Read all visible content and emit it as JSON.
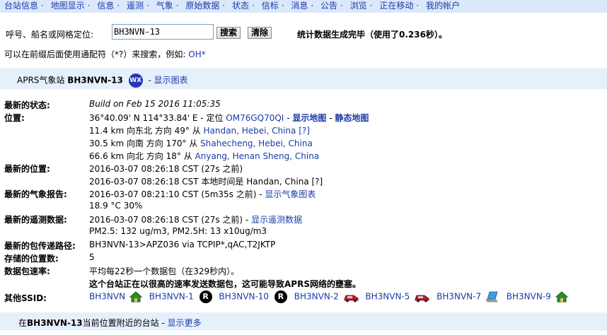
{
  "nav": {
    "items": [
      "台站信息",
      "地图显示",
      "信息",
      "遥测",
      "气象",
      "原始数据",
      "状态",
      "信标",
      "消息",
      "公告",
      "浏览",
      "正在移动",
      "我的帐户"
    ],
    "separator": "·"
  },
  "search": {
    "label": "呼号、船名或网格定位:",
    "value": "BH3NVN-13",
    "search_button": "搜索",
    "clear_button": "清除",
    "status": "统计数据生成完毕（使用了0.236秒）。",
    "hint_text": "可以在前缀后面使用通配符（*?）来搜索，例如:",
    "hint_example": "OH*"
  },
  "station": {
    "prefix": "APRS气象站",
    "callsign": "BH3NVN-13",
    "badge": "WX",
    "separator": "-",
    "chart_link": "显示图表"
  },
  "details": {
    "latest_status_label": "最新的状态:",
    "latest_status_value": "Build on Feb 15 2016 11:05:35",
    "position_label": "位置:",
    "position_coords": "36°40.09' N 114°33.84' E - 定位",
    "locator": "OM76GQ70QI",
    "dash": "-",
    "show_map": "显示地图",
    "static_map": "静态地图",
    "nearby_1_text": "11.4 km 向东北 方向 49° 从",
    "nearby_1_city": "Handan, Hebei, China",
    "nearby_1_q": "[?]",
    "nearby_2_text": "30.5 km 向南 方向 170° 从",
    "nearby_2_city": "Shahecheng, Hebei, China",
    "nearby_3_text": "66.6 km 向北 方向 18° 从",
    "nearby_3_city": "Anyang, Henan Sheng, China",
    "latest_pos_label": "最新的位置:",
    "latest_pos_time": "2016-03-07 08:26:18 CST (27s 之前)",
    "latest_pos_local": "2016-03-07 08:26:18 CST 本地时间是 Handan, China [?]",
    "weather_label": "最新的气象报告:",
    "weather_time": "2016-03-07 08:21:10 CST (5m35s 之前) -",
    "weather_link": "显示气象图表",
    "weather_values": "18.9 °C 30%",
    "telemetry_label": "最新的遥测数据:",
    "telemetry_time": "2016-03-07 08:26:18 CST (27s 之前) -",
    "telemetry_link": "显示遥测数据",
    "telemetry_values": "PM2.5: 132 ug/m3, PM2.5H: 13 x10ug/m3",
    "path_label": "最新的包传递路径:",
    "path_value": "BH3NVN-13>APZ036 via TCPIP*,qAC,T2JKTP",
    "stored_label": "存储的位置数:",
    "stored_value": "5",
    "rate_label": "数据包速率:",
    "rate_value": "平均每22秒一个数据包（在329秒内）。",
    "rate_warning": "这个台站正在以很高的速率发送数据包，这可能导致APRS网络的壅塞。",
    "ssid_label": "其他SSID:"
  },
  "ssids": [
    {
      "name": "BH3NVN",
      "icon": "house-icon"
    },
    {
      "name": "BH3NVN-1",
      "icon": "r-digipeater-icon"
    },
    {
      "name": "BH3NVN-10",
      "icon": "r-digipeater-icon"
    },
    {
      "name": "BH3NVN-2",
      "icon": "car-icon"
    },
    {
      "name": "BH3NVN-5",
      "icon": "car-icon"
    },
    {
      "name": "BH3NVN-7",
      "icon": "laptop-icon"
    },
    {
      "name": "BH3NVN-9",
      "icon": "house-icon"
    }
  ],
  "r_icon_letter": "R",
  "nearby_stations": {
    "prefix": "在",
    "callsign": "BH3NVN-13",
    "suffix": "当前位置附近的台站",
    "separator": "-",
    "more_link": "显示更多"
  }
}
